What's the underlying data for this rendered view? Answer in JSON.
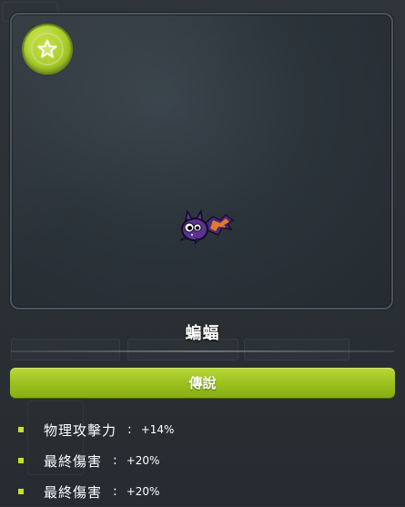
{
  "item": {
    "name": "蝙蝠",
    "grade": "傳說",
    "badge_icon": "star-icon"
  },
  "stats": [
    {
      "name": "物理攻擊力",
      "sep": ":",
      "value": "+14%"
    },
    {
      "name": "最終傷害",
      "sep": ":",
      "value": "+20%"
    },
    {
      "name": "最終傷害",
      "sep": ":",
      "value": "+20%"
    }
  ],
  "colors": {
    "grade_green": "#9cc21f",
    "badge_green": "#a9cc2a",
    "bullet": "#c8e02a"
  }
}
